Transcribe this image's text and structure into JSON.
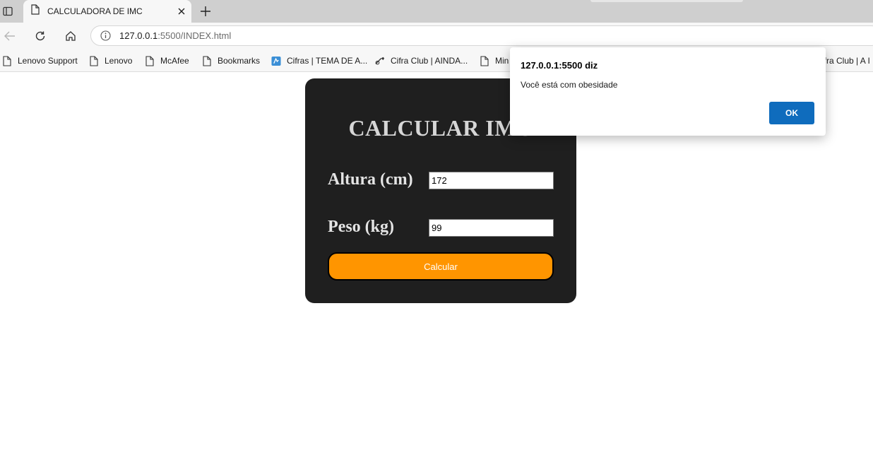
{
  "browser": {
    "tab_title": "CALCULADORA DE IMC",
    "url_host": "127.0.0.1",
    "url_path": ":5500/INDEX.html",
    "icons": {
      "tab_actions": "tab-actions-icon",
      "page": "page-icon",
      "close": "close-icon",
      "new_tab": "plus-icon",
      "back": "back-arrow-icon",
      "reload": "reload-icon",
      "home": "home-icon",
      "site_info": "info-icon"
    }
  },
  "bookmarks": [
    {
      "label": "Lenovo Support",
      "icon": "page-icon"
    },
    {
      "label": "Lenovo",
      "icon": "page-icon"
    },
    {
      "label": "McAfee",
      "icon": "page-icon"
    },
    {
      "label": "Bookmarks",
      "icon": "page-icon"
    },
    {
      "label": "Cifras | TEMA DE A...",
      "icon": "cifras-icon"
    },
    {
      "label": "Cifra Club | AINDA...",
      "icon": "guitar-icon"
    },
    {
      "label": "Min",
      "icon": "page-icon"
    },
    {
      "label": "ifra Club | A I",
      "icon": "guitar-icon"
    }
  ],
  "page": {
    "title": "CALCULAR IMC",
    "height_label": "Altura (cm)",
    "height_value": "172",
    "weight_label": "Peso (kg)",
    "weight_value": "99",
    "button_label": "Calcular",
    "card_color": "#1f1f1f",
    "button_color": "#ff9500"
  },
  "dialog": {
    "title": "127.0.0.1:5500 diz",
    "message": "Você está com obesidade",
    "ok_label": "OK",
    "ok_color": "#0f6cbd"
  }
}
